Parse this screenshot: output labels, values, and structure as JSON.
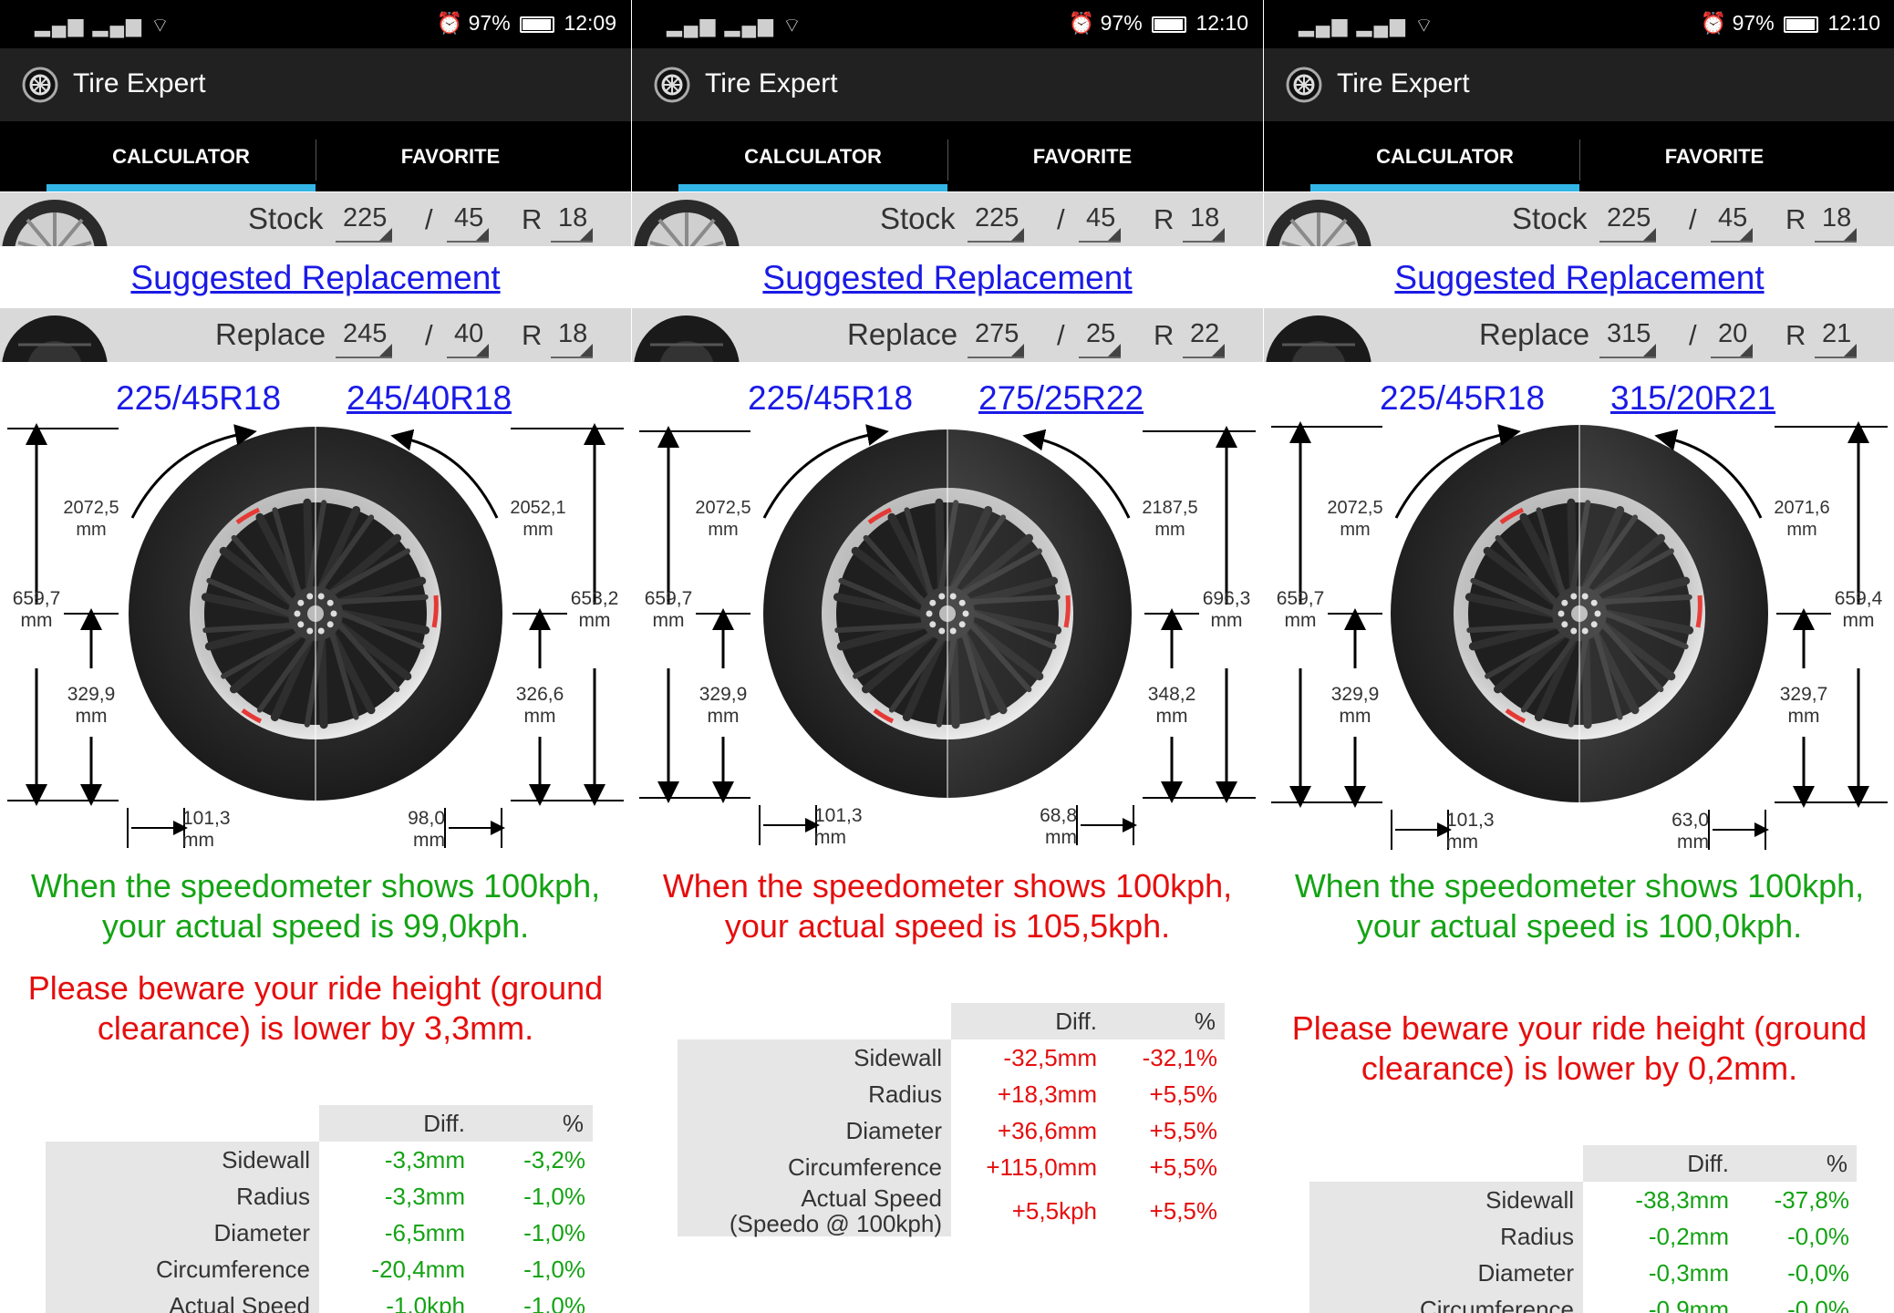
{
  "app": {
    "title": "Tire Expert",
    "tabs": [
      "CALCULATOR",
      "FAVORITE"
    ],
    "suggested_link": "Suggested Replacement",
    "stock_label": "Stock",
    "replace_label": "Replace",
    "slash": "/",
    "r": "R",
    "unit": "mm"
  },
  "colors": {
    "accent": "#33b5e5",
    "link": "#1a1ae6",
    "ok": "#14a314",
    "warn": "#e60d0d"
  },
  "table_headers": {
    "diff": "Diff.",
    "pct": "%"
  },
  "panels": [
    {
      "status": {
        "battery": "97%",
        "time": "12:09"
      },
      "stock": {
        "width": "225",
        "aspect": "45",
        "rim": "18"
      },
      "replace": {
        "width": "245",
        "aspect": "40",
        "rim": "18"
      },
      "stock_size": "225/45R18",
      "replace_size": "245/40R18",
      "left_circ": "2072,5\nmm",
      "right_circ": "2052,1\nmm",
      "left_diam": "659,7\nmm",
      "right_diam": "653,2\nmm",
      "left_radius": "329,9\nmm",
      "right_radius": "326,6\nmm",
      "left_side": "101,3\nmm",
      "right_side": "98,0\nmm",
      "speed_msg": "When the speedometer shows 100kph, your actual speed is 99,0kph.",
      "speed_status": "green",
      "ride_msg": "Please beware your ride height (ground clearance) is lower by 3,3mm.",
      "rows": [
        {
          "label": "Sidewall",
          "diff": "-3,3mm",
          "pct": "-3,2%"
        },
        {
          "label": "Radius",
          "diff": "-3,3mm",
          "pct": "-1,0%"
        },
        {
          "label": "Diameter",
          "diff": "-6,5mm",
          "pct": "-1,0%"
        },
        {
          "label": "Circumference",
          "diff": "-20,4mm",
          "pct": "-1,0%"
        },
        {
          "label": "Actual Speed",
          "diff": "-1,0kph",
          "pct": "-1,0%"
        }
      ]
    },
    {
      "status": {
        "battery": "97%",
        "time": "12:10"
      },
      "stock": {
        "width": "225",
        "aspect": "45",
        "rim": "18"
      },
      "replace": {
        "width": "275",
        "aspect": "25",
        "rim": "22"
      },
      "stock_size": "225/45R18",
      "replace_size": "275/25R22",
      "left_circ": "2072,5\nmm",
      "right_circ": "2187,5\nmm",
      "left_diam": "659,7\nmm",
      "right_diam": "696,3\nmm",
      "left_radius": "329,9\nmm",
      "right_radius": "348,2\nmm",
      "left_side": "101,3\nmm",
      "right_side": "68,8\nmm",
      "speed_msg": "When the speedometer shows 100kph, your actual speed is 105,5kph.",
      "speed_status": "red",
      "ride_msg": "",
      "rows": [
        {
          "label": "Sidewall",
          "diff": "-32,5mm",
          "pct": "-32,1%"
        },
        {
          "label": "Radius",
          "diff": "+18,3mm",
          "pct": "+5,5%"
        },
        {
          "label": "Diameter",
          "diff": "+36,6mm",
          "pct": "+5,5%"
        },
        {
          "label": "Circumference",
          "diff": "+115,0mm",
          "pct": "+5,5%"
        },
        {
          "label": "Actual Speed\n(Speedo @ 100kph)",
          "diff": "+5,5kph",
          "pct": "+5,5%"
        }
      ]
    },
    {
      "status": {
        "battery": "97%",
        "time": "12:10"
      },
      "stock": {
        "width": "225",
        "aspect": "45",
        "rim": "18"
      },
      "replace": {
        "width": "315",
        "aspect": "20",
        "rim": "21"
      },
      "stock_size": "225/45R18",
      "replace_size": "315/20R21",
      "left_circ": "2072,5\nmm",
      "right_circ": "2071,6\nmm",
      "left_diam": "659,7\nmm",
      "right_diam": "659,4\nmm",
      "left_radius": "329,9\nmm",
      "right_radius": "329,7\nmm",
      "left_side": "101,3\nmm",
      "right_side": "63,0\nmm",
      "speed_msg": "When the speedometer shows 100kph, your actual speed is 100,0kph.",
      "speed_status": "green",
      "ride_msg": "Please beware your ride height (ground clearance) is lower by 0,2mm.",
      "rows": [
        {
          "label": "Sidewall",
          "diff": "-38,3mm",
          "pct": "-37,8%"
        },
        {
          "label": "Radius",
          "diff": "-0,2mm",
          "pct": "-0,0%"
        },
        {
          "label": "Diameter",
          "diff": "-0,3mm",
          "pct": "-0,0%"
        },
        {
          "label": "Circumference",
          "diff": "-0,9mm",
          "pct": "-0,0%"
        }
      ]
    }
  ]
}
